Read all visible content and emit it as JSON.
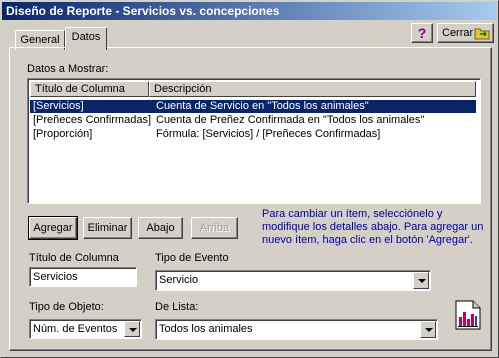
{
  "window": {
    "title": "Diseño de Reporte - Servicios vs. concepciones"
  },
  "toolbar": {
    "help_icon": "question-mark-icon",
    "close_label": "Cerrar",
    "close_icon": "folder-exit-icon"
  },
  "tabs": [
    {
      "label": "General",
      "active": false
    },
    {
      "label": "Datos",
      "active": true
    }
  ],
  "datos": {
    "section_label": "Datos a Mostrar:",
    "columns": [
      "Título de Columna",
      "Descripción"
    ],
    "rows": [
      {
        "titulo": "[Servicios]",
        "descripcion": "Cuenta de Servicio en \"Todos los animales\"",
        "selected": true
      },
      {
        "titulo": "[Preñeces Confirmadas]",
        "descripcion": "Cuenta de Preñez Confirmada en \"Todos los animales\"",
        "selected": false
      },
      {
        "titulo": "[Proporción]",
        "descripcion": "Fórmula: [Servicios] / [Preñeces Confirmadas]",
        "selected": false
      }
    ]
  },
  "buttons": {
    "agregar": "Agregar",
    "eliminar": "Eliminar",
    "abajo": "Abajo",
    "arriba": "Arriba"
  },
  "help_text": [
    "Para cambiar un ítem, selecciónelo y",
    "modifique los detalles abajo.  Para agregar un",
    "nuevo ítem, haga clic en el botón 'Agregar'."
  ],
  "fields": {
    "titulo_label": "Título de Columna",
    "titulo_value": "Servicios",
    "tipo_evento_label": "Tipo de Evento",
    "tipo_evento_value": "Servicio",
    "tipo_objeto_label": "Tipo de Objeto:",
    "tipo_objeto_value": "Núm. de Eventos",
    "de_lista_label": "De Lista:",
    "de_lista_value": "Todos los animales"
  },
  "colors": {
    "titlebar": "#0a246a",
    "selection": "#0a246a",
    "help_text": "#0000a0"
  },
  "report_icon": "report-chart-icon"
}
